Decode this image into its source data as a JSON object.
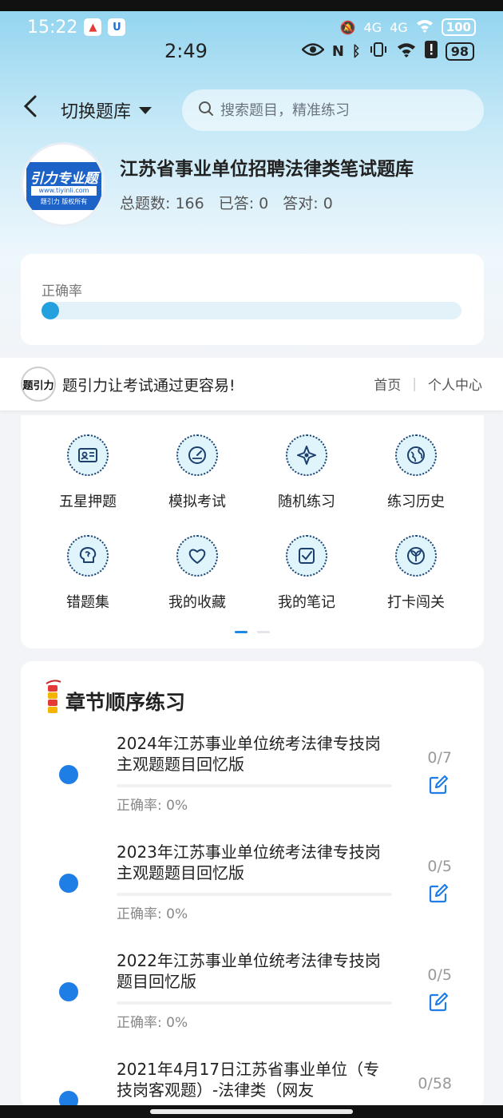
{
  "system_status": {
    "time": "15:22",
    "battery": "100",
    "network_1": "4G",
    "network_2": "4G"
  },
  "inner_status": {
    "time": "2:49",
    "battery": "98"
  },
  "nav": {
    "switch_label": "切换题库",
    "search_placeholder": "搜索题目，精准练习"
  },
  "bank": {
    "logo_main": "引力专业题",
    "logo_url": "www.tiyinli.com",
    "logo_foot": "题引力 版权所有",
    "title": "江苏省事业单位招聘法律类笔试题库",
    "stats": {
      "total_label": "总题数:",
      "total": "166",
      "answered_label": "已答:",
      "answered": "0",
      "correct_label": "答对:",
      "correct": "0"
    }
  },
  "accuracy": {
    "label": "正确率",
    "value": 0
  },
  "banner": {
    "logo_text": "题引力",
    "slogan": "题引力让考试通过更容易!",
    "home": "首页",
    "separator": "|",
    "personal": "个人中心"
  },
  "functions": [
    {
      "label": "五星押题",
      "icon": "id-card-icon"
    },
    {
      "label": "模拟考试",
      "icon": "gauge-icon"
    },
    {
      "label": "随机练习",
      "icon": "compass-icon"
    },
    {
      "label": "练习历史",
      "icon": "globe-icon"
    },
    {
      "label": "错题集",
      "icon": "brain-icon"
    },
    {
      "label": "我的收藏",
      "icon": "heart-icon"
    },
    {
      "label": "我的笔记",
      "icon": "note-check-icon"
    },
    {
      "label": "打卡闯关",
      "icon": "sprout-icon"
    }
  ],
  "pager": {
    "pages": 2,
    "active": 0
  },
  "chapters": {
    "title": "章节顺序练习",
    "accuracy_label": "正确率:",
    "items": [
      {
        "title": "2024年江苏事业单位统考法律专技岗主观题题目回忆版",
        "count": "0/7",
        "accuracy": "0%"
      },
      {
        "title": "2023年江苏事业单位统考法律专技岗主观题题目回忆版",
        "count": "0/5",
        "accuracy": "0%"
      },
      {
        "title": "2022年江苏事业单位统考法律专技岗题目回忆版",
        "count": "0/5",
        "accuracy": "0%"
      },
      {
        "title": "2021年4月17日江苏省事业单位（专技岗客观题）-法律类（网友",
        "count": "0/58",
        "accuracy": ""
      }
    ]
  },
  "colors": {
    "accent": "#1f7de6",
    "progress": "#23a0de",
    "top_gradient": "#8fd3ef"
  }
}
